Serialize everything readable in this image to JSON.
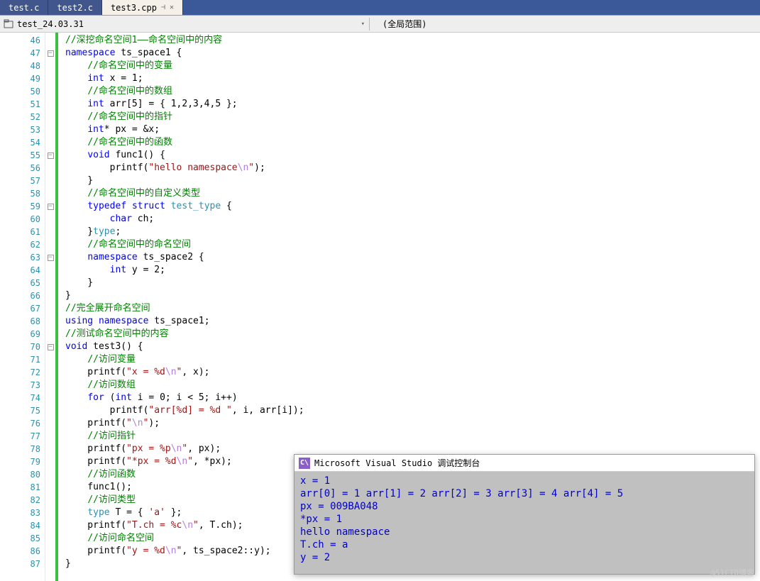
{
  "tabs": [
    {
      "label": "test.c"
    },
    {
      "label": "test2.c"
    },
    {
      "label": "test3.cpp",
      "active": true
    }
  ],
  "toolbar": {
    "project": "test_24.03.31",
    "scope": "(全局范围)"
  },
  "lines": {
    "start": 46,
    "end": 87
  },
  "code": [
    {
      "n": 46,
      "fold": "",
      "seg": [
        {
          "t": "//深挖命名空间1——命名空间中的内容",
          "c": "c-comment"
        }
      ]
    },
    {
      "n": 47,
      "fold": "⊟",
      "seg": [
        {
          "t": "namespace",
          "c": "c-keyword"
        },
        {
          "t": " ts_space1 {",
          "c": ""
        }
      ]
    },
    {
      "n": 48,
      "fold": "",
      "seg": [
        {
          "t": "    ",
          "c": ""
        },
        {
          "t": "//命名空间中的变量",
          "c": "c-comment"
        }
      ]
    },
    {
      "n": 49,
      "fold": "",
      "seg": [
        {
          "t": "    ",
          "c": ""
        },
        {
          "t": "int",
          "c": "c-keyword"
        },
        {
          "t": " x = 1;",
          "c": ""
        }
      ]
    },
    {
      "n": 50,
      "fold": "",
      "seg": [
        {
          "t": "    ",
          "c": ""
        },
        {
          "t": "//命名空间中的数组",
          "c": "c-comment"
        }
      ]
    },
    {
      "n": 51,
      "fold": "",
      "seg": [
        {
          "t": "    ",
          "c": ""
        },
        {
          "t": "int",
          "c": "c-keyword"
        },
        {
          "t": " arr[5] = { 1,2,3,4,5 };",
          "c": ""
        }
      ]
    },
    {
      "n": 52,
      "fold": "",
      "seg": [
        {
          "t": "    ",
          "c": ""
        },
        {
          "t": "//命名空间中的指针",
          "c": "c-comment"
        }
      ]
    },
    {
      "n": 53,
      "fold": "",
      "seg": [
        {
          "t": "    ",
          "c": ""
        },
        {
          "t": "int",
          "c": "c-keyword"
        },
        {
          "t": "* px = &x;",
          "c": ""
        }
      ]
    },
    {
      "n": 54,
      "fold": "",
      "seg": [
        {
          "t": "    ",
          "c": ""
        },
        {
          "t": "//命名空间中的函数",
          "c": "c-comment"
        }
      ]
    },
    {
      "n": 55,
      "fold": "⊟",
      "seg": [
        {
          "t": "    ",
          "c": ""
        },
        {
          "t": "void",
          "c": "c-keyword"
        },
        {
          "t": " func1() {",
          "c": ""
        }
      ]
    },
    {
      "n": 56,
      "fold": "",
      "seg": [
        {
          "t": "        printf(",
          "c": ""
        },
        {
          "t": "\"hello namespace",
          "c": "c-string"
        },
        {
          "t": "\\n",
          "c": "c-escape"
        },
        {
          "t": "\"",
          "c": "c-string"
        },
        {
          "t": ");",
          "c": ""
        }
      ]
    },
    {
      "n": 57,
      "fold": "",
      "seg": [
        {
          "t": "    }",
          "c": ""
        }
      ]
    },
    {
      "n": 58,
      "fold": "",
      "seg": [
        {
          "t": "    ",
          "c": ""
        },
        {
          "t": "//命名空间中的自定义类型",
          "c": "c-comment"
        }
      ]
    },
    {
      "n": 59,
      "fold": "⊟",
      "seg": [
        {
          "t": "    ",
          "c": ""
        },
        {
          "t": "typedef",
          "c": "c-keyword"
        },
        {
          "t": " ",
          "c": ""
        },
        {
          "t": "struct",
          "c": "c-keyword"
        },
        {
          "t": " ",
          "c": ""
        },
        {
          "t": "test_type",
          "c": "c-type"
        },
        {
          "t": " {",
          "c": ""
        }
      ]
    },
    {
      "n": 60,
      "fold": "",
      "seg": [
        {
          "t": "        ",
          "c": ""
        },
        {
          "t": "char",
          "c": "c-keyword"
        },
        {
          "t": " ch;",
          "c": ""
        }
      ]
    },
    {
      "n": 61,
      "fold": "",
      "seg": [
        {
          "t": "    }",
          "c": ""
        },
        {
          "t": "type",
          "c": "c-type"
        },
        {
          "t": ";",
          "c": ""
        }
      ]
    },
    {
      "n": 62,
      "fold": "",
      "seg": [
        {
          "t": "    ",
          "c": ""
        },
        {
          "t": "//命名空间中的命名空间",
          "c": "c-comment"
        }
      ]
    },
    {
      "n": 63,
      "fold": "⊟",
      "seg": [
        {
          "t": "    ",
          "c": ""
        },
        {
          "t": "namespace",
          "c": "c-keyword"
        },
        {
          "t": " ts_space2 {",
          "c": ""
        }
      ]
    },
    {
      "n": 64,
      "fold": "",
      "seg": [
        {
          "t": "        ",
          "c": ""
        },
        {
          "t": "int",
          "c": "c-keyword"
        },
        {
          "t": " y = 2;",
          "c": ""
        }
      ]
    },
    {
      "n": 65,
      "fold": "",
      "seg": [
        {
          "t": "    }",
          "c": ""
        }
      ]
    },
    {
      "n": 66,
      "fold": "",
      "seg": [
        {
          "t": "}",
          "c": ""
        }
      ]
    },
    {
      "n": 67,
      "fold": "",
      "seg": [
        {
          "t": "//完全展开命名空间",
          "c": "c-comment"
        }
      ]
    },
    {
      "n": 68,
      "fold": "",
      "seg": [
        {
          "t": "using",
          "c": "c-keyword"
        },
        {
          "t": " ",
          "c": ""
        },
        {
          "t": "namespace",
          "c": "c-keyword"
        },
        {
          "t": " ts_space1;",
          "c": ""
        }
      ]
    },
    {
      "n": 69,
      "fold": "",
      "seg": [
        {
          "t": "//测试命名空间中的内容",
          "c": "c-comment"
        }
      ]
    },
    {
      "n": 70,
      "fold": "⊟",
      "seg": [
        {
          "t": "void",
          "c": "c-keyword"
        },
        {
          "t": " test3() {",
          "c": ""
        }
      ]
    },
    {
      "n": 71,
      "fold": "",
      "seg": [
        {
          "t": "    ",
          "c": ""
        },
        {
          "t": "//访问变量",
          "c": "c-comment"
        }
      ]
    },
    {
      "n": 72,
      "fold": "",
      "seg": [
        {
          "t": "    printf(",
          "c": ""
        },
        {
          "t": "\"x = %d",
          "c": "c-string"
        },
        {
          "t": "\\n",
          "c": "c-escape"
        },
        {
          "t": "\"",
          "c": "c-string"
        },
        {
          "t": ", x);",
          "c": ""
        }
      ]
    },
    {
      "n": 73,
      "fold": "",
      "seg": [
        {
          "t": "    ",
          "c": ""
        },
        {
          "t": "//访问数组",
          "c": "c-comment"
        }
      ]
    },
    {
      "n": 74,
      "fold": "",
      "seg": [
        {
          "t": "    ",
          "c": ""
        },
        {
          "t": "for",
          "c": "c-keyword"
        },
        {
          "t": " (",
          "c": ""
        },
        {
          "t": "int",
          "c": "c-keyword"
        },
        {
          "t": " i = 0; i < 5; i++)",
          "c": ""
        }
      ]
    },
    {
      "n": 75,
      "fold": "",
      "seg": [
        {
          "t": "        printf(",
          "c": ""
        },
        {
          "t": "\"arr[%d] = %d \"",
          "c": "c-string"
        },
        {
          "t": ", i, arr[i]);",
          "c": ""
        }
      ]
    },
    {
      "n": 76,
      "fold": "",
      "seg": [
        {
          "t": "    printf(",
          "c": ""
        },
        {
          "t": "\"",
          "c": "c-string"
        },
        {
          "t": "\\n",
          "c": "c-escape"
        },
        {
          "t": "\"",
          "c": "c-string"
        },
        {
          "t": ");",
          "c": ""
        }
      ]
    },
    {
      "n": 77,
      "fold": "",
      "seg": [
        {
          "t": "    ",
          "c": ""
        },
        {
          "t": "//访问指针",
          "c": "c-comment"
        }
      ]
    },
    {
      "n": 78,
      "fold": "",
      "seg": [
        {
          "t": "    printf(",
          "c": ""
        },
        {
          "t": "\"px = %p",
          "c": "c-string"
        },
        {
          "t": "\\n",
          "c": "c-escape"
        },
        {
          "t": "\"",
          "c": "c-string"
        },
        {
          "t": ", px);",
          "c": ""
        }
      ]
    },
    {
      "n": 79,
      "fold": "",
      "seg": [
        {
          "t": "    printf(",
          "c": ""
        },
        {
          "t": "\"*px = %d",
          "c": "c-string"
        },
        {
          "t": "\\n",
          "c": "c-escape"
        },
        {
          "t": "\"",
          "c": "c-string"
        },
        {
          "t": ", *px);",
          "c": ""
        }
      ]
    },
    {
      "n": 80,
      "fold": "",
      "seg": [
        {
          "t": "    ",
          "c": ""
        },
        {
          "t": "//访问函数",
          "c": "c-comment"
        }
      ]
    },
    {
      "n": 81,
      "fold": "",
      "seg": [
        {
          "t": "    func1();",
          "c": ""
        }
      ]
    },
    {
      "n": 82,
      "fold": "",
      "seg": [
        {
          "t": "    ",
          "c": ""
        },
        {
          "t": "//访问类型",
          "c": "c-comment"
        }
      ]
    },
    {
      "n": 83,
      "fold": "",
      "seg": [
        {
          "t": "    ",
          "c": ""
        },
        {
          "t": "type",
          "c": "c-type"
        },
        {
          "t": " T = { ",
          "c": ""
        },
        {
          "t": "'a'",
          "c": "c-string"
        },
        {
          "t": " };",
          "c": ""
        }
      ]
    },
    {
      "n": 84,
      "fold": "",
      "seg": [
        {
          "t": "    printf(",
          "c": ""
        },
        {
          "t": "\"T.ch = %c",
          "c": "c-string"
        },
        {
          "t": "\\n",
          "c": "c-escape"
        },
        {
          "t": "\"",
          "c": "c-string"
        },
        {
          "t": ", T.ch);",
          "c": ""
        }
      ]
    },
    {
      "n": 85,
      "fold": "",
      "seg": [
        {
          "t": "    ",
          "c": ""
        },
        {
          "t": "//访问命名空间",
          "c": "c-comment"
        }
      ]
    },
    {
      "n": 86,
      "fold": "",
      "seg": [
        {
          "t": "    printf(",
          "c": ""
        },
        {
          "t": "\"y = %d",
          "c": "c-string"
        },
        {
          "t": "\\n",
          "c": "c-escape"
        },
        {
          "t": "\"",
          "c": "c-string"
        },
        {
          "t": ", ts_space2::y);",
          "c": ""
        }
      ]
    },
    {
      "n": 87,
      "fold": "",
      "seg": [
        {
          "t": "}",
          "c": ""
        }
      ]
    }
  ],
  "console": {
    "title": "Microsoft Visual Studio 调试控制台",
    "output": "x = 1\narr[0] = 1 arr[1] = 2 arr[2] = 3 arr[3] = 4 arr[4] = 5\npx = 009BA048\n*px = 1\nhello namespace\nT.ch = a\ny = 2"
  },
  "watermark": "@51CTO博客"
}
